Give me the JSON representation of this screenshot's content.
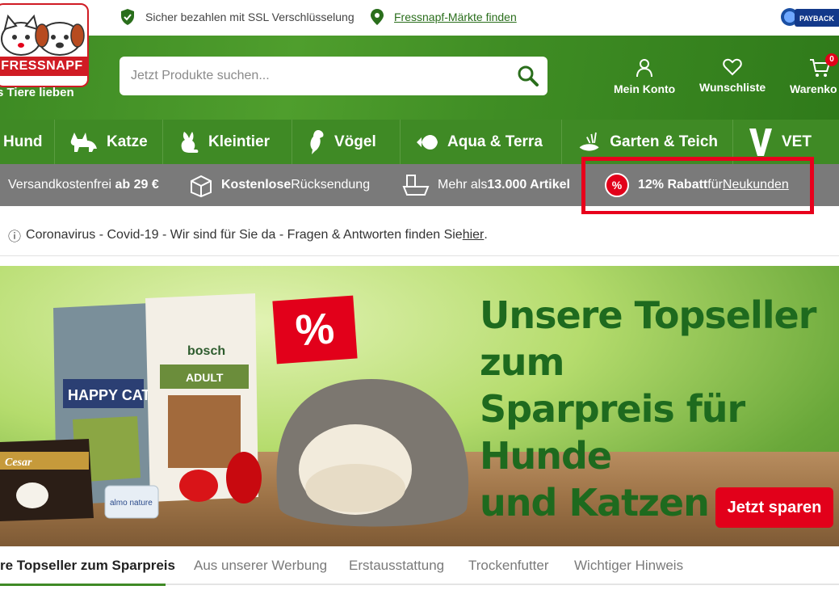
{
  "topbar": {
    "ssl_text": "Sicher bezahlen mit SSL Verschlüsselung",
    "stores_link": "Fressnapf-Märkte finden",
    "payback_label": "PAYBACK"
  },
  "header": {
    "logo_text": "FRESSNAPF",
    "slogan": "s Tiere lieben",
    "search_placeholder": "Jetzt Produkte suchen...",
    "account_label": "Mein Konto",
    "wishlist_label": "Wunschliste",
    "cart_label": "Warenko",
    "cart_count": "0"
  },
  "categories": [
    {
      "label": "Hund",
      "icon": "dog-icon"
    },
    {
      "label": "Katze",
      "icon": "cat-icon"
    },
    {
      "label": "Kleintier",
      "icon": "rabbit-icon"
    },
    {
      "label": "Vögel",
      "icon": "bird-icon"
    },
    {
      "label": "Aqua & Terra",
      "icon": "fish-icon"
    },
    {
      "label": "Garten & Teich",
      "icon": "pond-icon"
    },
    {
      "label": "VET",
      "icon": "vet-logo-icon"
    }
  ],
  "usp": {
    "shipping_prefix": "Versandkostenfrei ",
    "shipping_bold": "ab 29 €",
    "return_bold": "Kostenlose",
    "return_suffix": " Rücksendung",
    "items_prefix": "Mehr als ",
    "items_bold": "13.000 Artikel",
    "discount_bold": "12% Rabatt",
    "discount_mid": " für ",
    "discount_link": "Neukunden"
  },
  "notice": {
    "icon": "ⓘ",
    "text": "Coronavirus - Covid-19 - Wir sind für Sie da - Fragen & Antworten finden Sie ",
    "link": "hier",
    "end": "."
  },
  "hero": {
    "title_line1": "Unsere Topseller zum",
    "title_line2": "Sparpreis für Hunde",
    "title_line3": "und Katzen",
    "percent": "%",
    "cta": "Jetzt sparen",
    "product_labels": [
      "HAPPY CAT",
      "bosch",
      "ADULT",
      "Cesar",
      "almo nature"
    ]
  },
  "tabs": [
    {
      "label": "re Topseller zum Sparpreis",
      "active": true
    },
    {
      "label": "Aus unserer Werbung",
      "active": false
    },
    {
      "label": "Erstausstattung",
      "active": false
    },
    {
      "label": "Trockenfutter",
      "active": false
    },
    {
      "label": "Wichtiger Hinweis",
      "active": false
    }
  ],
  "colors": {
    "brand_green": "#3f8a25",
    "brand_red": "#e2001a",
    "usp_gray": "#7a7a7a",
    "highlight_red": "#e8001c"
  }
}
